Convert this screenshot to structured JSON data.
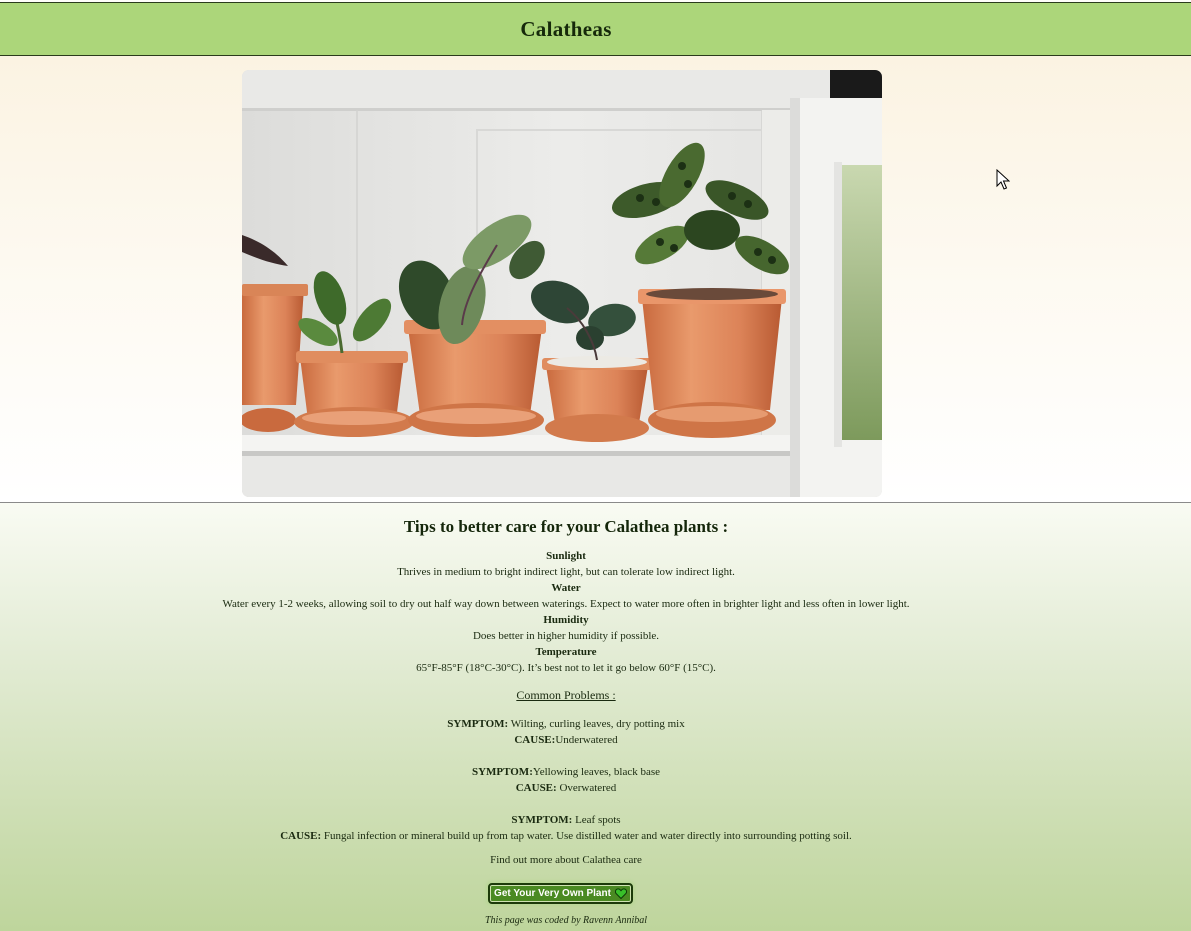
{
  "header": {
    "title": "Calatheas"
  },
  "tips": {
    "title": "Tips to better care for your Calathea plants :",
    "items": [
      {
        "heading": "Sunlight",
        "text": "Thrives in medium to bright indirect light, but can tolerate low indirect light."
      },
      {
        "heading": "Water",
        "text": "Water every 1-2 weeks, allowing soil to dry out half way down between waterings. Expect to water more often in brighter light and less often in lower light."
      },
      {
        "heading": "Humidity",
        "text": "Does better in higher humidity if possible."
      },
      {
        "heading": "Temperature",
        "text": "65°F-85°F (18°C-30°C). It’s best not to let it go below 60°F (15°C)."
      }
    ]
  },
  "problems": {
    "title": "Common Problems :",
    "symptom_label": "SYMPTOM:",
    "cause_label": "CAUSE:",
    "items": [
      {
        "symptom": " Wilting, curling leaves, dry potting mix",
        "cause": "Underwatered"
      },
      {
        "symptom": "Yellowing leaves, black base",
        "cause": " Overwatered"
      },
      {
        "symptom": " Leaf spots",
        "cause": " Fungal infection or mineral build up from tap water. Use distilled water and water directly into surrounding potting soil."
      }
    ]
  },
  "more_link": "Find out more about Calathea care",
  "cta": {
    "label": "Get Your Very Own Plant",
    "icon": "heart-icon"
  },
  "footer": "This page was coded by Ravenn Annibal",
  "colors": {
    "header_bg": "#acd67a",
    "cta_bg": "#4a8a22",
    "heart": "#38c02a"
  }
}
